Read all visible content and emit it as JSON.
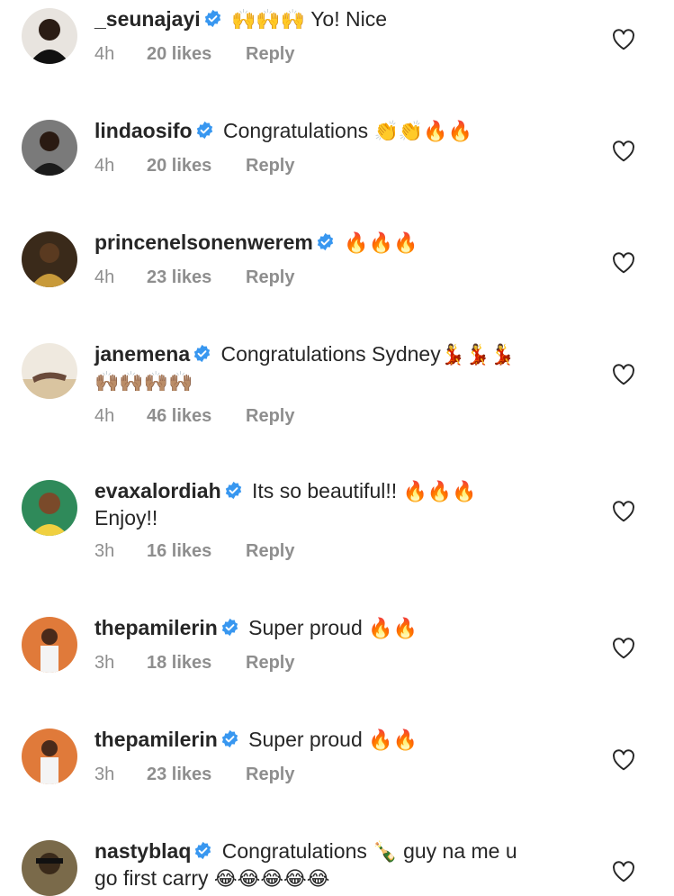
{
  "comments": [
    {
      "username": "_seunajayi",
      "text": "Yo! Nice",
      "emoji_before": "🙌🙌🙌",
      "emoji_after": "",
      "text2": "",
      "emoji2": "",
      "time": "4h",
      "likes": "20 likes",
      "reply": "Reply",
      "avatar_bg": "#2b2b2b"
    },
    {
      "username": "lindaosifo",
      "text": "Congratulations",
      "emoji_before": "",
      "emoji_after": "👏👏🔥🔥",
      "text2": "",
      "emoji2": "",
      "time": "4h",
      "likes": "20 likes",
      "reply": "Reply",
      "avatar_bg": "#6e6e6e"
    },
    {
      "username": "princenelsonenwerem",
      "text": "",
      "emoji_before": "🔥🔥🔥",
      "emoji_after": "",
      "text2": "",
      "emoji2": "",
      "time": "4h",
      "likes": "23 likes",
      "reply": "Reply",
      "avatar_bg": "#3a2a1a"
    },
    {
      "username": "janemena",
      "text": "Congratulations Sydney",
      "emoji_before": "",
      "emoji_after": "💃💃💃",
      "text2": "",
      "emoji2": "🙌🏽🙌🏽🙌🏽🙌🏽",
      "time": "4h",
      "likes": "46 likes",
      "reply": "Reply",
      "avatar_bg": "#e9e3d9"
    },
    {
      "username": "evaxalordiah",
      "text": "Its so beautiful!!",
      "emoji_before": "",
      "emoji_after": "🔥🔥🔥",
      "text2": "Enjoy!!",
      "emoji2": "",
      "time": "3h",
      "likes": "16 likes",
      "reply": "Reply",
      "avatar_bg": "#1f7a4a"
    },
    {
      "username": "thepamilerin",
      "text": "Super proud",
      "emoji_before": "",
      "emoji_after": "🔥🔥",
      "text2": "",
      "emoji2": "",
      "time": "3h",
      "likes": "18 likes",
      "reply": "Reply",
      "avatar_bg": "#e07a3a"
    },
    {
      "username": "thepamilerin",
      "text": "Super proud",
      "emoji_before": "",
      "emoji_after": "🔥🔥",
      "text2": "",
      "emoji2": "",
      "time": "3h",
      "likes": "23 likes",
      "reply": "Reply",
      "avatar_bg": "#e07a3a"
    },
    {
      "username": "nastyblaq",
      "text": "Congratulations",
      "emoji_before": "",
      "emoji_after": "🍾",
      "text2": "guy na me u",
      "emoji2": "",
      "text3": "go first carry",
      "emoji3": "😂😂😂😂😂",
      "time": "",
      "likes": "",
      "reply": "",
      "avatar_bg": "#4a3a2a"
    }
  ],
  "colors": {
    "username": "#262626",
    "text": "#262626",
    "meta": "#8e8e8e",
    "verified": "#3897f0",
    "heart_stroke": "#262626"
  },
  "icons": {
    "verified": "verified-badge-icon",
    "heart": "heart-outline-icon"
  }
}
